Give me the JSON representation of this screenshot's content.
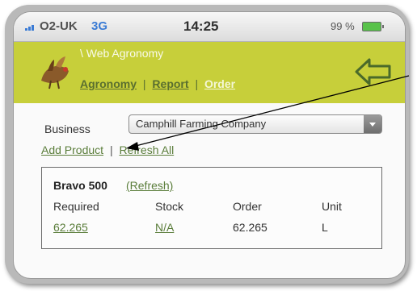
{
  "status_bar": {
    "carrier": "O2-UK",
    "network": "3G",
    "time": "14:25",
    "battery": "99 %",
    "colors": {
      "network": "#3a7bd5",
      "battery_fill": "#58c24a"
    }
  },
  "header": {
    "title": "\\ Web Agronomy",
    "nav": {
      "agronomy": "Agronomy",
      "report": "Report",
      "order": "Order",
      "separator": "|"
    },
    "background": "#c7cf3a",
    "icons": {
      "logo": "pheasant-logo-icon",
      "back": "back-arrow-icon"
    }
  },
  "business": {
    "label": "Business",
    "selected": "Camphill Farming Company"
  },
  "actions": {
    "add_product": "Add Product",
    "separator": "|",
    "refresh_all": "Refresh All"
  },
  "product": {
    "name": "Bravo 500",
    "refresh": "(Refresh)",
    "columns": [
      "Required",
      "Stock",
      "Order",
      "Unit"
    ],
    "values": [
      "62.265",
      "N/A",
      "62.265",
      "L"
    ]
  }
}
